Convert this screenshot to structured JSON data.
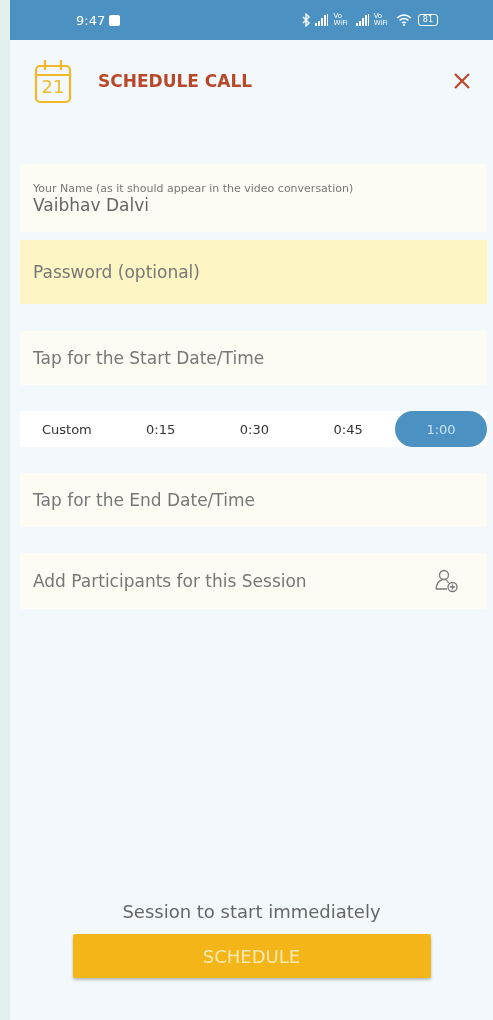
{
  "status_bar": {
    "time": "9:47",
    "vowifi": [
      {
        "top": "Vo",
        "bottom": "WiFi"
      },
      {
        "top": "Vo",
        "bottom": "WiFi"
      }
    ],
    "battery": "81"
  },
  "header": {
    "date": "21",
    "title": "SCHEDULE CALL"
  },
  "fields": [
    {
      "kind": "labeled",
      "label": "Your Name (as it should appear in the video conversation)",
      "value": "Vaibhav  Dalvi",
      "focused": false
    },
    {
      "kind": "plain",
      "placeholder": "Password (optional)",
      "focused": true
    },
    {
      "kind": "plain",
      "placeholder": "Tap for the Start Date/Time",
      "focused": false
    },
    {
      "kind": "durations",
      "options": [
        {
          "label": "Custom",
          "selected": false
        },
        {
          "label": "0:15",
          "selected": false
        },
        {
          "label": "0:30",
          "selected": false
        },
        {
          "label": "0:45",
          "selected": false
        },
        {
          "label": "1:00",
          "selected": true
        }
      ]
    },
    {
      "kind": "plain",
      "placeholder": "Tap for the End Date/Time",
      "focused": false
    },
    {
      "kind": "participants",
      "placeholder": "Add Participants for this Session",
      "focused": false
    }
  ],
  "footer": {
    "note": "Session to start immediately",
    "button": "SCHEDULE"
  }
}
